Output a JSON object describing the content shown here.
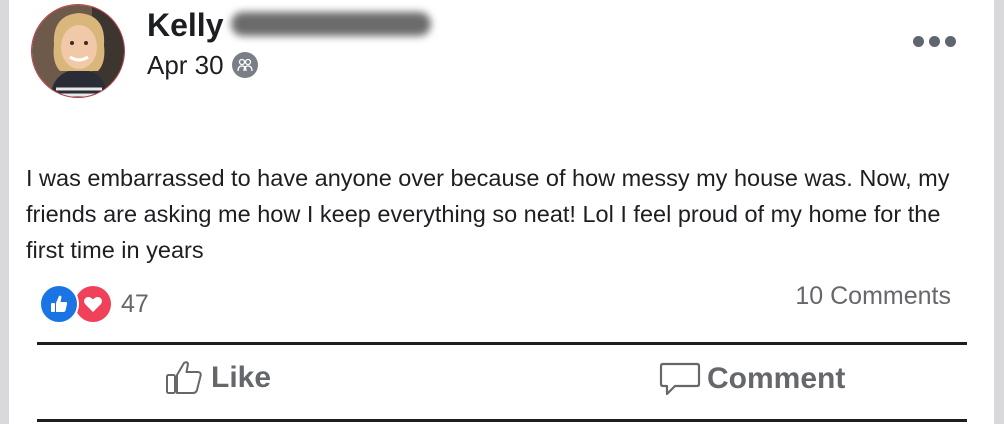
{
  "post": {
    "author_name": "Kelly",
    "date": "Apr 30",
    "privacy_icon": "friends-icon",
    "text": "I was embarrassed to have anyone over because of how messy my house was. Now, my friends are asking me how I keep everything so neat! Lol I feel proud of my home for the first time in years"
  },
  "reactions": {
    "types": [
      "like",
      "love"
    ],
    "count": "47"
  },
  "comments": {
    "label": "10 Comments"
  },
  "actions": {
    "like_label": "Like",
    "comment_label": "Comment"
  },
  "colors": {
    "like_blue": "#1b74e4",
    "love_red": "#f0415a",
    "secondary_text": "#65676b"
  }
}
